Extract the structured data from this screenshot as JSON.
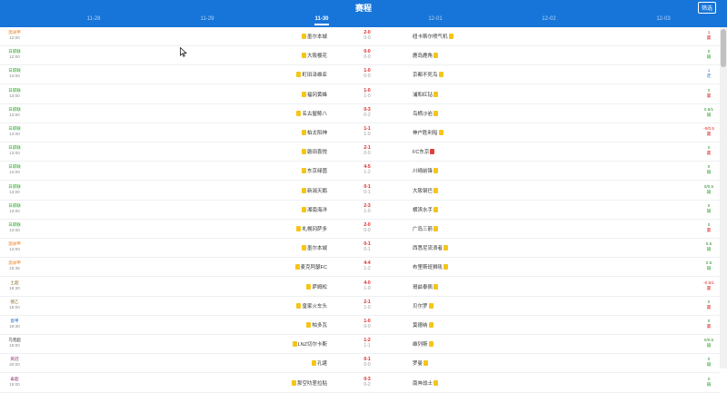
{
  "header": {
    "title": "赛程",
    "filter_label": "筛选",
    "dates": [
      {
        "label": "11-28",
        "active": false
      },
      {
        "label": "11-29",
        "active": false
      },
      {
        "label": "11-30",
        "active": true
      },
      {
        "label": "12-01",
        "active": false
      },
      {
        "label": "12-02",
        "active": false
      },
      {
        "label": "12-03",
        "active": false
      }
    ]
  },
  "colors": {
    "header_bg": "#1775d9",
    "score_red": "#e02020",
    "handicap_green": "#2a8a2a",
    "league_green": "#2aa52a",
    "league_orange": "#e8822a",
    "result_win": "#e02020",
    "result_lose": "#2aa52a",
    "result_draw": "#2a6fd9"
  },
  "matches": [
    {
      "league": "澳洲甲",
      "time": "12:00",
      "league_color": "#e8822a",
      "home": "墨尔本城",
      "home_rank": "",
      "home_rank_side": "left",
      "home_red": false,
      "score": "2-0",
      "half": "0-0",
      "away": "纽卡斯尔喷气机",
      "away_rank": "",
      "away_red": false,
      "handicap": "1",
      "result": "赢",
      "result_color": "#e02020",
      "handicap_color": "#e02020"
    },
    {
      "league": "日职联",
      "time": "12:00",
      "league_color": "#2aa52a",
      "home": "大阪樱花",
      "home_rank": "",
      "home_red": false,
      "score": "0-0",
      "half": "0-0",
      "away": "鹿岛鹿角",
      "away_rank": "",
      "away_red": false,
      "handicap": "0",
      "result": "输",
      "result_color": "#2aa52a",
      "handicap_color": "#2a8a2a"
    },
    {
      "league": "日职联",
      "time": "13:00",
      "league_color": "#2aa52a",
      "home": "町田泽维亚",
      "home_rank": "",
      "home_red": false,
      "score": "1-0",
      "half": "0-0",
      "away": "京都不死鸟",
      "away_rank": "",
      "away_red": false,
      "handicap": "1",
      "result": "走",
      "result_color": "#2a6fd9",
      "handicap_color": "#2a6fd9"
    },
    {
      "league": "日职联",
      "time": "13:00",
      "league_color": "#2aa52a",
      "home": "福冈黄蜂",
      "home_rank": "",
      "home_red": false,
      "score": "1-0",
      "half": "1-0",
      "away": "浦和红钻",
      "away_rank": "",
      "away_red": false,
      "handicap": "0",
      "result": "赢",
      "result_color": "#e02020",
      "handicap_color": "#2a8a2a"
    },
    {
      "league": "日职联",
      "time": "13:00",
      "league_color": "#2aa52a",
      "home": "名古屋鲸八",
      "home_rank": "",
      "home_red": false,
      "score": "0-3",
      "half": "0-2",
      "away": "鸟栖沙岩",
      "away_rank": "",
      "away_red": false,
      "handicap": "0.5/1",
      "result": "输",
      "result_color": "#2aa52a",
      "handicap_color": "#2a8a2a"
    },
    {
      "league": "日职联",
      "time": "13:00",
      "league_color": "#2aa52a",
      "home": "柏太阳神",
      "home_rank": "",
      "home_red": false,
      "score": "1-1",
      "half": "1-0",
      "away": "神户胜利船",
      "away_rank": "",
      "away_red": false,
      "handicap": "-0/0.5",
      "result": "赢",
      "result_color": "#e02020",
      "handicap_color": "#e02020"
    },
    {
      "league": "日职联",
      "time": "13:00",
      "league_color": "#2aa52a",
      "home": "磐田喜悦",
      "home_rank": "",
      "home_red": false,
      "score": "2-1",
      "half": "0-0",
      "away": "FC东京",
      "away_rank": "",
      "away_red": true,
      "handicap": "0",
      "result": "赢",
      "result_color": "#e02020",
      "handicap_color": "#2a8a2a"
    },
    {
      "league": "日职联",
      "time": "13:00",
      "league_color": "#2aa52a",
      "home": "东京绿茵",
      "home_rank": "",
      "home_red": false,
      "score": "4-5",
      "half": "1-2",
      "away": "川崎前锋",
      "away_rank": "",
      "away_red": false,
      "handicap": "0",
      "result": "输",
      "result_color": "#2aa52a",
      "handicap_color": "#2a8a2a"
    },
    {
      "league": "日职联",
      "time": "13:00",
      "league_color": "#2aa52a",
      "home": "新潟天鹅",
      "home_rank": "",
      "home_red": false,
      "score": "0-1",
      "half": "0-1",
      "away": "大阪钢巴",
      "away_rank": "",
      "away_red": false,
      "handicap": "0/0.5",
      "result": "输",
      "result_color": "#2aa52a",
      "handicap_color": "#2a8a2a"
    },
    {
      "league": "日职联",
      "time": "13:00",
      "league_color": "#2aa52a",
      "home": "湘南海洋",
      "home_rank": "",
      "home_red": false,
      "score": "2-3",
      "half": "1-0",
      "away": "横滨水手",
      "away_rank": "",
      "away_red": false,
      "handicap": "0",
      "result": "输",
      "result_color": "#2aa52a",
      "handicap_color": "#2a8a2a"
    },
    {
      "league": "日职联",
      "time": "13:00",
      "league_color": "#2aa52a",
      "home": "札幌冈萨多",
      "home_rank": "",
      "home_red": false,
      "score": "2-0",
      "half": "0-0",
      "away": "广岛三箭",
      "away_rank": "",
      "away_red": false,
      "handicap": "0",
      "result": "赢",
      "result_color": "#e02020",
      "handicap_color": "#2a8a2a"
    },
    {
      "league": "澳洲甲",
      "time": "14:00",
      "league_color": "#e8822a",
      "home": "墨尔本城",
      "home_rank": "",
      "home_red": false,
      "score": "0-1",
      "half": "0-1",
      "away": "西悉尼流浪者",
      "away_rank": "",
      "away_red": false,
      "handicap": "0.5",
      "result": "输",
      "result_color": "#2aa52a",
      "handicap_color": "#2a8a2a"
    },
    {
      "league": "澳洲甲",
      "time": "16:35",
      "league_color": "#e8822a",
      "home": "麦克阿瑟FC",
      "home_rank": "",
      "home_red": false,
      "score": "4-4",
      "half": "1-2",
      "away": "布里斯班狮吼",
      "away_rank": "",
      "away_red": false,
      "handicap": "0.5",
      "result": "输",
      "result_color": "#2aa52a",
      "handicap_color": "#2a8a2a"
    },
    {
      "league": "土超",
      "time": "18:30",
      "league_color": "#8a6d2a",
      "home": "萨姆松",
      "home_rank": "",
      "home_red": false,
      "score": "4-0",
      "half": "1-0",
      "away": "哥兹泰佩",
      "away_rank": "",
      "away_red": false,
      "handicap": "-0.5/1",
      "result": "赢",
      "result_color": "#e02020",
      "handicap_color": "#e02020"
    },
    {
      "league": "德乙",
      "time": "19:00",
      "league_color": "#8a6d2a",
      "home": "皇家火车头",
      "home_rank": "",
      "home_red": false,
      "score": "2-1",
      "half": "1-0",
      "away": "贝尔罗",
      "away_rank": "",
      "away_red": false,
      "handicap": "0",
      "result": "赢",
      "result_color": "#e02020",
      "handicap_color": "#2a8a2a"
    },
    {
      "league": "意甲",
      "time": "19:30",
      "league_color": "#2a6fd9",
      "home": "帕多瓦",
      "home_rank": "",
      "home_red": false,
      "score": "1-0",
      "half": "0-0",
      "away": "莫德纳",
      "away_rank": "",
      "away_red": false,
      "handicap": "0",
      "result": "赢",
      "result_color": "#e02020",
      "handicap_color": "#2a8a2a"
    },
    {
      "league": "乌克超",
      "time": "19:00",
      "league_color": "#333333",
      "home": "LNZ切尔卡斯",
      "home_rank": "",
      "home_red": false,
      "score": "1-2",
      "half": "1-1",
      "away": "维列斯",
      "away_rank": "",
      "away_red": false,
      "handicap": "0/0.5",
      "result": "输",
      "result_color": "#2aa52a",
      "handicap_color": "#2a8a2a"
    },
    {
      "league": "英冠",
      "time": "20:00",
      "league_color": "#8a2a6d",
      "home": "孔堪",
      "home_rank": "",
      "home_red": false,
      "score": "0-1",
      "half": "0-0",
      "away": "罗曼",
      "away_rank": "",
      "away_red": false,
      "handicap": "0",
      "result": "输",
      "result_color": "#2aa52a",
      "handicap_color": "#2a8a2a"
    },
    {
      "league": "泰超",
      "time": "19:00",
      "league_color": "#8a2a6d",
      "home": "那空叻差拉贴",
      "home_rank": "",
      "home_red": false,
      "score": "0-3",
      "half": "0-2",
      "away": "南奔战士",
      "away_rank": "",
      "away_red": false,
      "handicap": "0",
      "result": "输",
      "result_color": "#2aa52a",
      "handicap_color": "#2a8a2a"
    }
  ]
}
